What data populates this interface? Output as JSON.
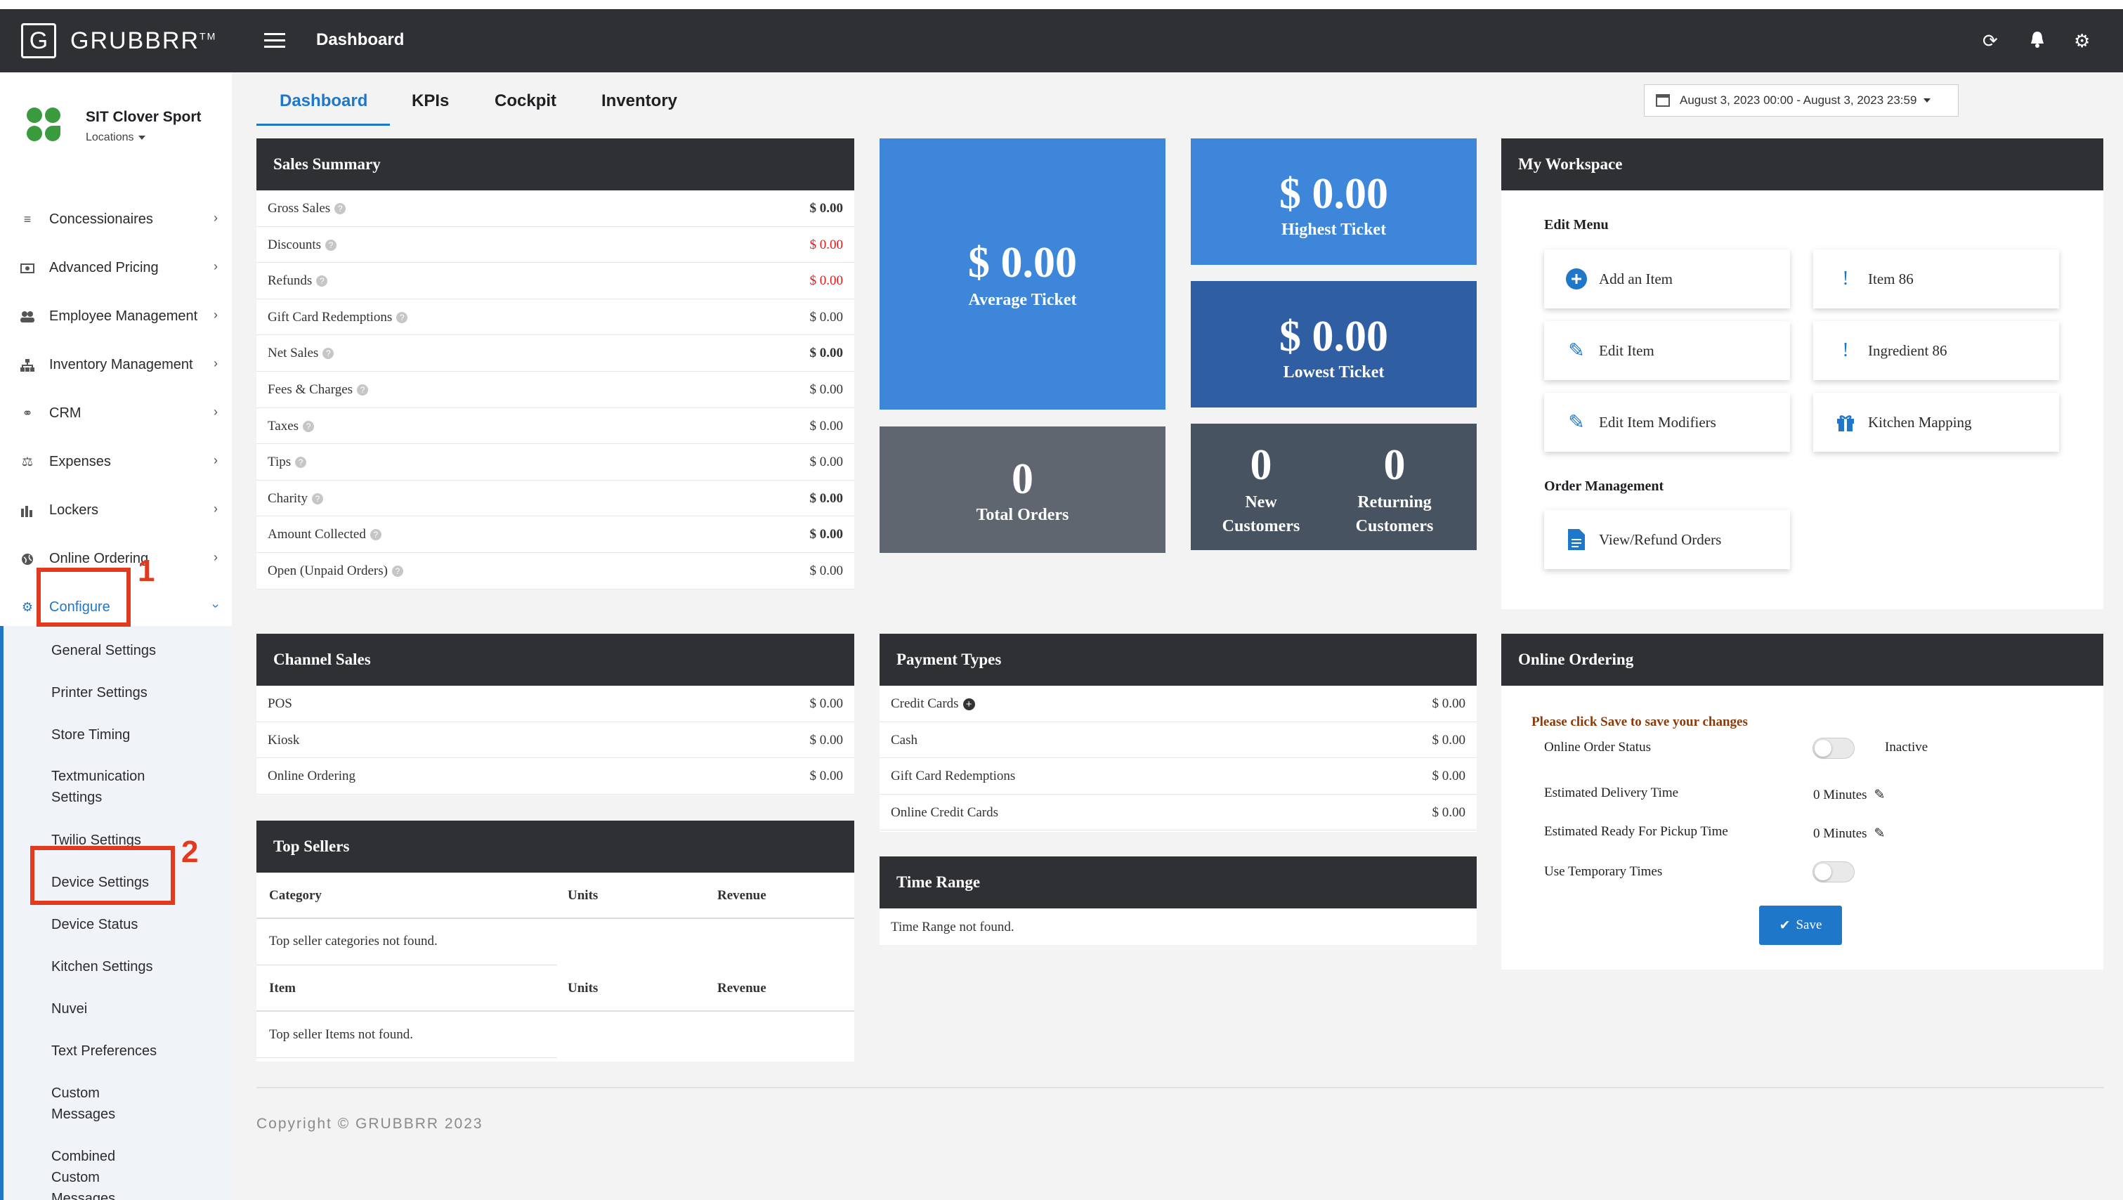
{
  "brand": {
    "letter": "G",
    "name": "GRUBBRR",
    "tm": "TM"
  },
  "store": {
    "name": "SIT Clover Sport",
    "location_label": "Locations"
  },
  "sidebar": {
    "items": [
      {
        "label": "Concessionaires",
        "icon": "list-icon"
      },
      {
        "label": "Advanced Pricing",
        "icon": "money-icon"
      },
      {
        "label": "Employee Management",
        "icon": "users-icon"
      },
      {
        "label": "Inventory Management",
        "icon": "sitemap-icon"
      },
      {
        "label": "CRM",
        "icon": "link-icon"
      },
      {
        "label": "Expenses",
        "icon": "scale-icon"
      },
      {
        "label": "Lockers",
        "icon": "lockers-icon"
      },
      {
        "label": "Online Ordering",
        "icon": "globe-icon"
      },
      {
        "label": "Configure",
        "icon": "gear-icon"
      }
    ],
    "sub_items": [
      "General Settings",
      "Printer Settings",
      "Store Timing",
      "Textmunication\nSettings",
      "Twilio Settings",
      "Device Settings",
      "Device Status",
      "Kitchen Settings",
      "Nuvei",
      "Text Preferences",
      "Custom\nMessages",
      "Combined\nCustom\nMessages"
    ]
  },
  "annotations": {
    "one": "1",
    "two": "2"
  },
  "header": {
    "title": "Dashboard"
  },
  "tabs": [
    "Dashboard",
    "KPIs",
    "Cockpit",
    "Inventory"
  ],
  "date_range": "August 3, 2023 00:00 - August 3, 2023 23:59",
  "sales_summary": {
    "title": "Sales Summary",
    "rows": [
      {
        "label": "Gross Sales",
        "value": "$ 0.00",
        "style": "bold"
      },
      {
        "label": "Discounts",
        "value": "$ 0.00",
        "style": "red"
      },
      {
        "label": "Refunds",
        "value": "$ 0.00",
        "style": "red"
      },
      {
        "label": "Gift Card Redemptions",
        "value": "$ 0.00",
        "style": ""
      },
      {
        "label": "Net Sales",
        "value": "$ 0.00",
        "style": "bold"
      },
      {
        "label": "Fees & Charges",
        "value": "$ 0.00",
        "style": ""
      },
      {
        "label": "Taxes",
        "value": "$ 0.00",
        "style": ""
      },
      {
        "label": "Tips",
        "value": "$ 0.00",
        "style": ""
      },
      {
        "label": "Charity",
        "value": "$ 0.00",
        "style": "bold"
      },
      {
        "label": "Amount Collected",
        "value": "$ 0.00",
        "style": "bold"
      },
      {
        "label": "Open (Unpaid Orders)",
        "value": "$ 0.00",
        "style": ""
      }
    ]
  },
  "tiles": {
    "average": {
      "value": "$ 0.00",
      "label": "Average Ticket"
    },
    "highest": {
      "value": "$ 0.00",
      "label": "Highest Ticket"
    },
    "lowest": {
      "value": "$ 0.00",
      "label": "Lowest Ticket"
    },
    "total_orders": {
      "value": "0",
      "label": "Total Orders"
    },
    "new_customers": {
      "value": "0",
      "label": "New\nCustomers"
    },
    "returning_customers": {
      "value": "0",
      "label": "Returning\nCustomers"
    }
  },
  "workspace": {
    "title": "My Workspace",
    "edit_menu_label": "Edit Menu",
    "order_mgmt_label": "Order Management",
    "buttons": {
      "add_item": "Add an Item",
      "item86": "Item 86",
      "edit_item": "Edit Item",
      "ingredient86": "Ingredient 86",
      "edit_modifiers": "Edit Item Modifiers",
      "kitchen_mapping": "Kitchen Mapping",
      "view_refund": "View/Refund Orders"
    }
  },
  "channel_sales": {
    "title": "Channel Sales",
    "rows": [
      {
        "label": "POS",
        "value": "$ 0.00"
      },
      {
        "label": "Kiosk",
        "value": "$ 0.00"
      },
      {
        "label": "Online Ordering",
        "value": "$ 0.00"
      }
    ]
  },
  "payment_types": {
    "title": "Payment Types",
    "rows": [
      {
        "label": "Credit Cards",
        "value": "$ 0.00"
      },
      {
        "label": "Cash",
        "value": "$ 0.00"
      },
      {
        "label": "Gift Card Redemptions",
        "value": "$ 0.00"
      },
      {
        "label": "Online Credit Cards",
        "value": "$ 0.00"
      }
    ]
  },
  "top_sellers": {
    "title": "Top Sellers",
    "cat_headers": [
      "Category",
      "Units",
      "Revenue"
    ],
    "cat_empty": "Top seller categories not found.",
    "item_headers": [
      "Item",
      "Units",
      "Revenue"
    ],
    "item_empty": "Top seller Items not found."
  },
  "time_range": {
    "title": "Time Range",
    "empty": "Time Range not found."
  },
  "online_ordering": {
    "title": "Online Ordering",
    "notice": "Please click Save to save your changes",
    "status_label": "Online Order Status",
    "status_value": "Inactive",
    "delivery_label": "Estimated Delivery Time",
    "delivery_value": "0 Minutes",
    "pickup_label": "Estimated Ready For Pickup Time",
    "pickup_value": "0 Minutes",
    "temp_label": "Use Temporary Times",
    "save_label": "Save"
  },
  "footer": {
    "copyright": "Copyright © GRUBBRR 2023"
  },
  "colors": {
    "accent": "#1f77c9",
    "dark": "#2f3034",
    "tile_blue": "#3d86d9",
    "tile_blue_dark": "#2f5ea3",
    "tile_gray": "#5f6670",
    "tile_slate": "#475361",
    "annotation_red": "#e23a1e"
  }
}
